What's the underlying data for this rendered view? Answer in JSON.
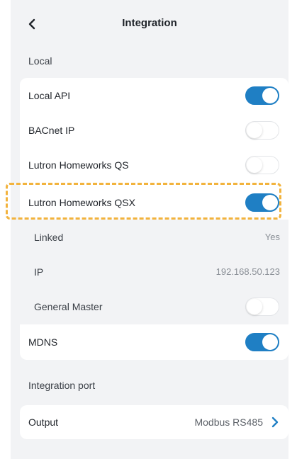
{
  "header": {
    "title": "Integration"
  },
  "sections": {
    "local": "Local",
    "port": "Integration port"
  },
  "local_items": {
    "local_api": {
      "label": "Local API",
      "on": true
    },
    "bacnet": {
      "label": "BACnet IP",
      "on": false
    },
    "homeworks_qs": {
      "label": "Lutron Homeworks QS",
      "on": false
    },
    "homeworks_qsx": {
      "label": "Lutron Homeworks QSX",
      "on": true
    },
    "linked": {
      "label": "Linked",
      "value": "Yes"
    },
    "ip": {
      "label": "IP",
      "value": "192.168.50.123"
    },
    "general_master": {
      "label": "General Master",
      "on": false
    },
    "mdns": {
      "label": "MDNS",
      "on": true
    }
  },
  "port": {
    "output_label": "Output",
    "output_value": "Modbus RS485"
  },
  "colors": {
    "accent": "#1f7fc4",
    "highlight": "#f2b33d"
  },
  "icons": {
    "back": "chevron-left-icon",
    "forward": "chevron-right-icon"
  }
}
